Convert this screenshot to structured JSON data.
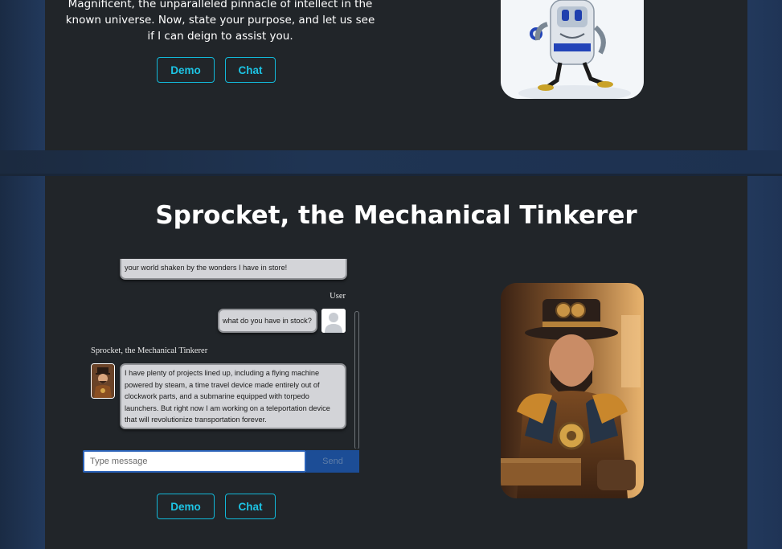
{
  "intro": {
    "text": "Magnificent, the unparalleled pinnacle of intellect in the known universe. Now, state your purpose, and let us see if I can deign to assist you."
  },
  "buttons": {
    "demo_label": "Demo",
    "chat_label": "Chat"
  },
  "section": {
    "title": "Sprocket, the Mechanical Tinkerer"
  },
  "chat": {
    "messages": [
      {
        "role": "bot",
        "text": "your world shaken by the wonders I have in store!"
      },
      {
        "role": "user",
        "sender": "User",
        "text": "what do you have in stock?"
      },
      {
        "role": "bot",
        "sender": "Sprocket, the Mechanical Tinkerer",
        "text": "I have plenty of projects lined up, including a flying machine powered by steam, a time travel device made entirely out of clockwork parts, and a submarine equipped with torpedo launchers. But right now I am working on a teleportation device that will revolutionize transportation forever."
      }
    ],
    "input_placeholder": "Type message",
    "send_label": "Send"
  },
  "icons": {
    "user_avatar": "user-silhouette-icon",
    "bot_avatar": "steampunk-tinkerer-portrait"
  },
  "colors": {
    "page_bg": "#212529",
    "accent": "#1dc4e4",
    "send_button": "#1c4d96",
    "bubble": "#d3d4d8"
  }
}
